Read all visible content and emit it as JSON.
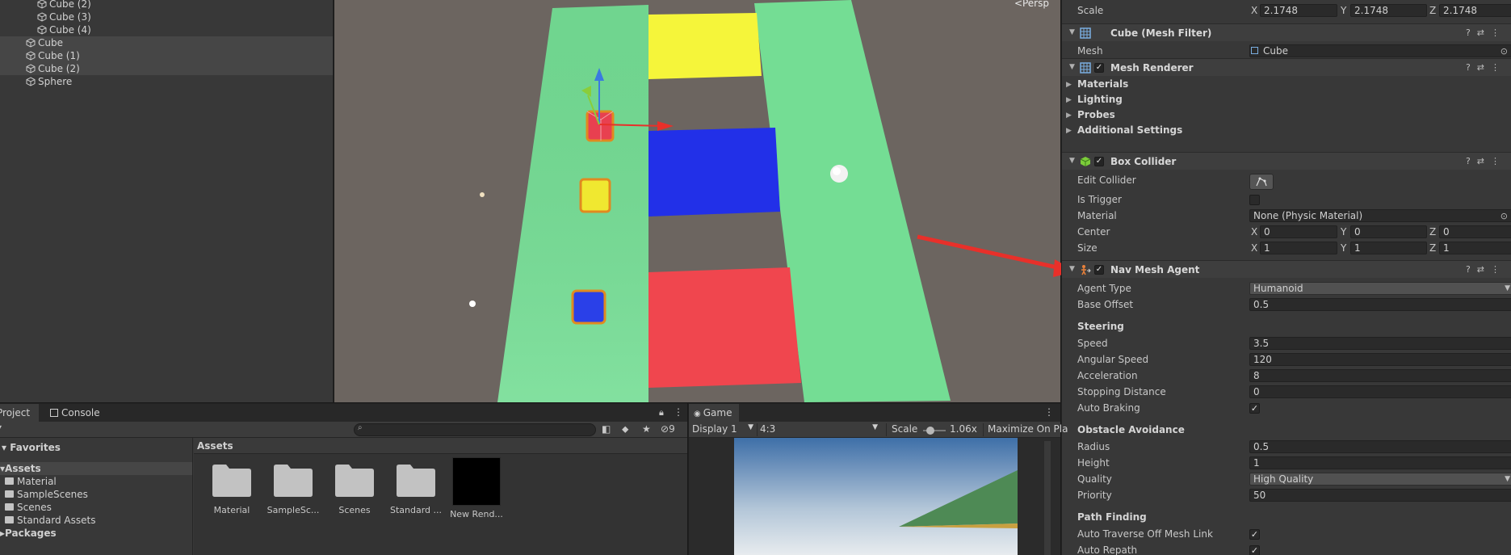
{
  "hierarchy": {
    "items": [
      {
        "label": "Cube (2)",
        "indent": 2,
        "selected": false
      },
      {
        "label": "Cube (3)",
        "indent": 2,
        "selected": false
      },
      {
        "label": "Cube (4)",
        "indent": 2,
        "selected": false
      },
      {
        "label": "Cube",
        "indent": 1,
        "selected": true
      },
      {
        "label": "Cube (1)",
        "indent": 1,
        "selected": true
      },
      {
        "label": "Cube (2)",
        "indent": 1,
        "selected": true
      },
      {
        "label": "Sphere",
        "indent": 1,
        "selected": false
      }
    ]
  },
  "scene": {
    "persp_label": "<Persp"
  },
  "inspector": {
    "transform": {
      "scale_label": "Scale",
      "scale": {
        "x": "2.1748",
        "y": "2.1748",
        "z": "2.1748"
      }
    },
    "mesh_filter": {
      "title": "Cube (Mesh Filter)",
      "mesh_label": "Mesh",
      "mesh_value": "Cube"
    },
    "mesh_renderer": {
      "title": "Mesh Renderer",
      "sections": [
        "Materials",
        "Lighting",
        "Probes",
        "Additional Settings"
      ]
    },
    "box_collider": {
      "title": "Box Collider",
      "edit_collider_label": "Edit Collider",
      "is_trigger_label": "Is Trigger",
      "material_label": "Material",
      "material_value": "None (Physic Material)",
      "center_label": "Center",
      "center": {
        "x": "0",
        "y": "0",
        "z": "0"
      },
      "size_label": "Size",
      "size": {
        "x": "1",
        "y": "1",
        "z": "1"
      }
    },
    "nav_mesh_agent": {
      "title": "Nav Mesh Agent",
      "agent_type_label": "Agent Type",
      "agent_type_value": "Humanoid",
      "base_offset_label": "Base Offset",
      "base_offset_value": "0.5",
      "steering_label": "Steering",
      "speed_label": "Speed",
      "speed_value": "3.5",
      "angular_speed_label": "Angular Speed",
      "angular_speed_value": "120",
      "acceleration_label": "Acceleration",
      "acceleration_value": "8",
      "stopping_distance_label": "Stopping Distance",
      "stopping_distance_value": "0",
      "auto_braking_label": "Auto Braking",
      "obstacle_avoidance_label": "Obstacle Avoidance",
      "radius_label": "Radius",
      "radius_value": "0.5",
      "height_label": "Height",
      "height_value": "1",
      "quality_label": "Quality",
      "quality_value": "High Quality",
      "priority_label": "Priority",
      "priority_value": "50",
      "path_finding_label": "Path Finding",
      "auto_traverse_label": "Auto Traverse Off Mesh Link",
      "auto_repath_label": "Auto Repath"
    },
    "axis_labels": {
      "x": "X",
      "y": "Y",
      "z": "Z"
    }
  },
  "project": {
    "tab_project": "Project",
    "tab_console": "Console",
    "hidden_count": "9",
    "favorites_label": "Favorites",
    "assets_label": "Assets",
    "tree": [
      "Material",
      "SampleScenes",
      "Scenes",
      "Standard Assets"
    ],
    "packages_label": "Packages",
    "breadcrumb": "Assets",
    "tiles": [
      "Material",
      "SampleSc...",
      "Scenes",
      "Standard ...",
      "New Rend..."
    ]
  },
  "game": {
    "tab_label": "Game",
    "display": "Display 1",
    "aspect": "4:3",
    "scale_label": "Scale",
    "scale_value": "1.06x",
    "maximize": "Maximize On Pla"
  },
  "colors": {
    "ground": "#6c6560",
    "lane_green": "#74dd94",
    "yellow_zone": "#f5f53a",
    "blue_zone": "#2230e8",
    "red_zone": "#f0464e",
    "annotation_arrow": "#e8302a"
  }
}
